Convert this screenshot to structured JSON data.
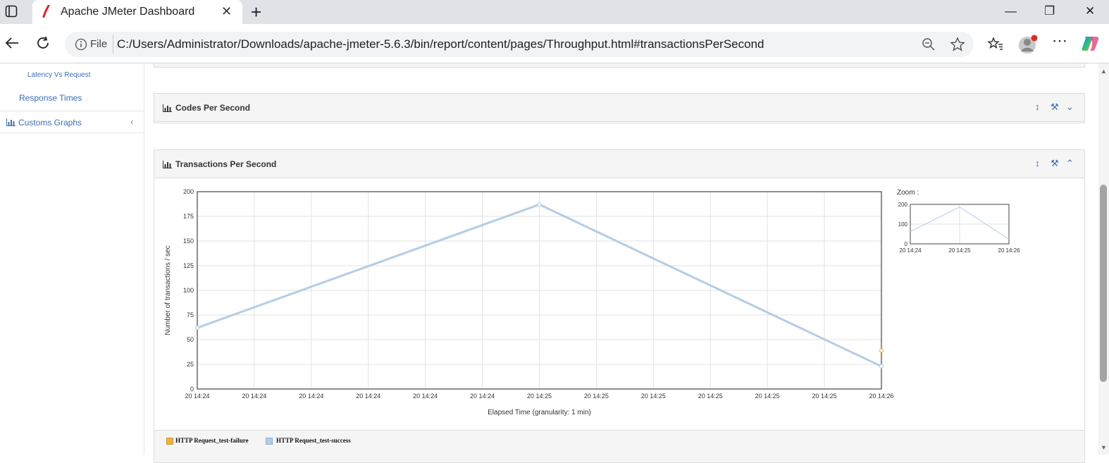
{
  "browser": {
    "tab_title": "Apache JMeter Dashboard",
    "tab_close": "✕",
    "new_tab": "+",
    "file_label": "File",
    "url": "C:/Users/Administrator/Downloads/apache-jmeter-5.6.3/bin/report/content/pages/Throughput.html#transactionsPerSecond",
    "minimize": "—",
    "restore": "❐",
    "close": "✕"
  },
  "sidebar": {
    "items": [
      {
        "label": "Latency Vs Request"
      },
      {
        "label": "Response Times"
      },
      {
        "label": "Customs Graphs",
        "icon": "chart-icon",
        "chevron": "‹"
      }
    ]
  },
  "panels": {
    "codes": {
      "title": "Codes Per Second"
    },
    "tps": {
      "title": "Transactions Per Second"
    },
    "icon": "bar-chart-icon"
  },
  "zoom": {
    "label": "Zoom :"
  },
  "chart_data": [
    {
      "type": "line",
      "title": "",
      "xlabel": "Elapsed Time (granularity: 1 min)",
      "ylabel": "Number of transactions / sec",
      "ylim": [
        0,
        200
      ],
      "yticks": [
        0,
        25,
        50,
        75,
        100,
        125,
        150,
        175,
        200
      ],
      "x_tick_labels": [
        "20 14:24",
        "20 14:24",
        "20 14:24",
        "20 14:24",
        "20 14:24",
        "20 14:24",
        "20 14:25",
        "20 14:25",
        "20 14:25",
        "20 14:25",
        "20 14:25",
        "20 14:25",
        "20 14:26"
      ],
      "x": [
        "20 14:24",
        "20 14:25",
        "20 14:26"
      ],
      "series": [
        {
          "name": "HTTP Request_test-failure",
          "color": "#f0b43c",
          "values": [
            null,
            null,
            39
          ]
        },
        {
          "name": "HTTP Request_test-success",
          "color": "#b4cde6",
          "values": [
            62,
            187,
            23
          ]
        }
      ],
      "grid": true,
      "legend": "bottom"
    },
    {
      "type": "line",
      "title": "Zoom :",
      "ylim": [
        0,
        200
      ],
      "yticks": [
        0,
        100,
        200
      ],
      "x_tick_labels": [
        "20 14:24",
        "20 14:25",
        "20 14:26"
      ],
      "series": [
        {
          "name": "HTTP Request_test-success",
          "color": "#b4cde6",
          "values": [
            62,
            187,
            23
          ]
        }
      ]
    }
  ]
}
